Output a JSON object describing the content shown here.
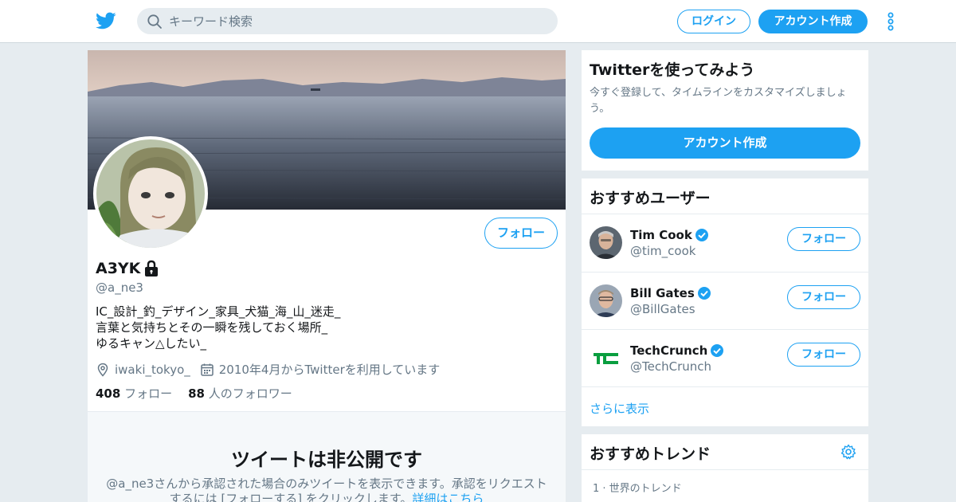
{
  "header": {
    "search_placeholder": "キーワード検索",
    "login_label": "ログイン",
    "signup_label": "アカウント作成",
    "brand_color": "#1da1f2"
  },
  "profile": {
    "name": "A3YK",
    "handle": "@a_ne3",
    "bio": [
      "IC_設計_釣_デザイン_家具_犬猫_海_山_迷走_",
      "言葉と気持ちとその一瞬を残しておく場所_",
      "ゆるキャン△したい_"
    ],
    "location": "iwaki_tokyo_",
    "joined": "2010年4月からTwitterを利用しています",
    "following_count": "408",
    "following_label": "フォロー",
    "followers_count": "88",
    "followers_label": "人のフォロワー",
    "follow_button": "フォロー",
    "icons": {
      "location": "location-pin-icon",
      "calendar": "calendar-icon",
      "lock": "lock-icon"
    }
  },
  "private_notice": {
    "title": "ツイートは非公開です",
    "text": "@a_ne3さんから承認された場合のみツイートを表示できます。承認をリクエストするには [フォローする] をクリックします。",
    "link": "詳細はこちら"
  },
  "start_card": {
    "title": "Twitterを使ってみよう",
    "subtitle": "今すぐ登録して、タイムラインをカスタマイズしましょう。",
    "button": "アカウント作成"
  },
  "recommended": {
    "title": "おすすめユーザー",
    "users": [
      {
        "name": "Tim Cook",
        "handle": "@tim_cook",
        "follow": "フォロー",
        "verified": true
      },
      {
        "name": "Bill Gates",
        "handle": "@BillGates",
        "follow": "フォロー",
        "verified": true
      },
      {
        "name": "TechCrunch",
        "handle": "@TechCrunch",
        "follow": "フォロー",
        "verified": true
      }
    ],
    "more": "さらに表示"
  },
  "trends": {
    "title": "おすすめトレンド",
    "items": [
      {
        "meta": "1 · 世界のトレンド",
        "name": ""
      }
    ]
  }
}
